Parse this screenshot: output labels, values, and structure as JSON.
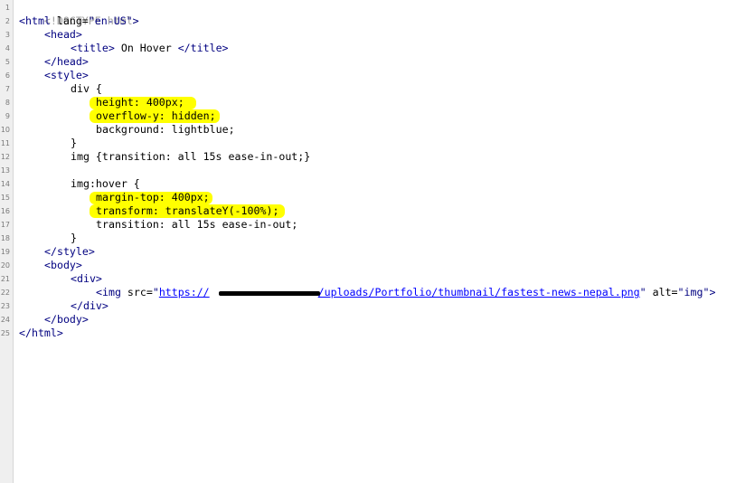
{
  "line_numbers": [
    "1",
    "2",
    "3",
    "4",
    "5",
    "6",
    "7",
    "8",
    "9",
    "10",
    "11",
    "12",
    "13",
    "14",
    "15",
    "16",
    "17",
    "18",
    "19",
    "20",
    "21",
    "22",
    "23",
    "24",
    "25"
  ],
  "code": {
    "l1": "<!DOCTYPE html>",
    "l2_open": "<html",
    "l2_attr": " lang=",
    "l2_val": "\"en-US\"",
    "l2_close": ">",
    "l3": "<head>",
    "l4_open": "<title>",
    "l4_text": " On Hover ",
    "l4_close": "</title>",
    "l5": "</head>",
    "l6": "<style>",
    "l7": "div {",
    "l8": "height: 400px;",
    "l9": "overflow-y: hidden;",
    "l10": "background: lightblue;",
    "l11": "}",
    "l12": "img {transition: all 15s ease-in-out;}",
    "l14": "img:hover {",
    "l15": "margin-top: 400px;",
    "l16": "transform: translateY(-100%);",
    "l17": "transition: all 15s ease-in-out;",
    "l18": "}",
    "l19": "</style>",
    "l20": "<body>",
    "l21": "<div>",
    "l22_open": "<img",
    "l22_attr1": " src=",
    "l22_q1": "\"",
    "l22_link_a": "https://",
    "l22_link_b": "/uploads/Portfolio/thumbnail/fastest-news-nepal.png",
    "l22_q2": "\"",
    "l22_attr2": " alt=",
    "l22_val2": "\"img\"",
    "l22_close": ">",
    "l23": "</div>",
    "l24": "</body>",
    "l25": "</html>"
  },
  "colors": {
    "highlight": "#ffff00",
    "tag": "#000080",
    "link": "#0000ff",
    "doctype": "#a0a0a0"
  }
}
